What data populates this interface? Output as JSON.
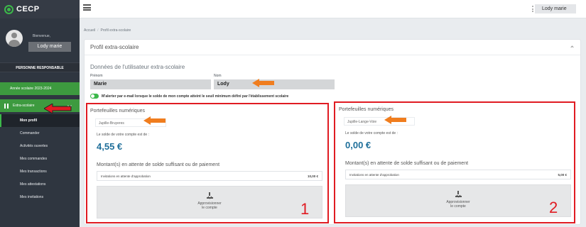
{
  "app": {
    "logo_text": "CECP"
  },
  "sidebar": {
    "welcome": "Bienvenue,",
    "user_name": "Lody marie",
    "section_label": "PERSONNE RESPONSABLE",
    "school_year": "Année scolaire 2023-2024",
    "extra_menu": "Extra-scolaire",
    "items": [
      {
        "label": "Mon profil",
        "active": true
      },
      {
        "label": "Commander"
      },
      {
        "label": "Activités ouvertes"
      },
      {
        "label": "Mes commandes"
      },
      {
        "label": "Mes transactions"
      },
      {
        "label": "Mes attestations"
      },
      {
        "label": "Mes invitations"
      }
    ]
  },
  "topbar": {
    "user_name": "Lody marie"
  },
  "breadcrumb": {
    "home": "Accueil",
    "sep": "/",
    "current": "Profil extra-scolaire"
  },
  "card": {
    "title": "Profil extra-scolaire",
    "section_title": "Données de l'utilisateur extra-scolaire",
    "firstname_label": "Prénom",
    "firstname_value": "Marie",
    "lastname_label": "Nom",
    "lastname_value": "Lody",
    "alert_toggle_on": true,
    "alert_label": "M'alerter par e-mail lorsque le solde de mon compte atteint le seuil minimum défini par l'établissement scolaire"
  },
  "wallets": [
    {
      "title": "Portefeuilles numériques",
      "school": "Jupille-Bruyeres",
      "balance_label": "Le solde de votre compte est de :",
      "balance": "4,55 €",
      "pending_title": "Montant(s) en attente de solde suffisant ou de paiement",
      "pending_label": "Invitations en attente d'approbation",
      "pending_amount": "10,00 €",
      "topup_line1": "Approvisionner",
      "topup_line2": "le compte",
      "marker": "1"
    },
    {
      "title": "Portefeuilles numériques",
      "school": "Jupille-Lange-Voie",
      "balance_label": "Le solde de votre compte est de :",
      "balance": "0,00 €",
      "pending_title": "Montant(s) en attente de solde suffisant ou de paiement",
      "pending_label": "Invitations en attente d'approbation",
      "pending_amount": "5,00 €",
      "topup_line1": "Approvisionner",
      "topup_line2": "le compte",
      "marker": "2"
    }
  ],
  "colors": {
    "annotation_red": "#e01b22",
    "arrow_orange": "#f07d1e",
    "brand_green": "#3cb84a",
    "amount_blue": "#1f6f9a"
  },
  "icons": [
    "menu-icon",
    "kebab-icon",
    "chevron-down-icon",
    "chevron-up-icon",
    "download-icon",
    "arrow-left-icon",
    "toggle-icon"
  ]
}
